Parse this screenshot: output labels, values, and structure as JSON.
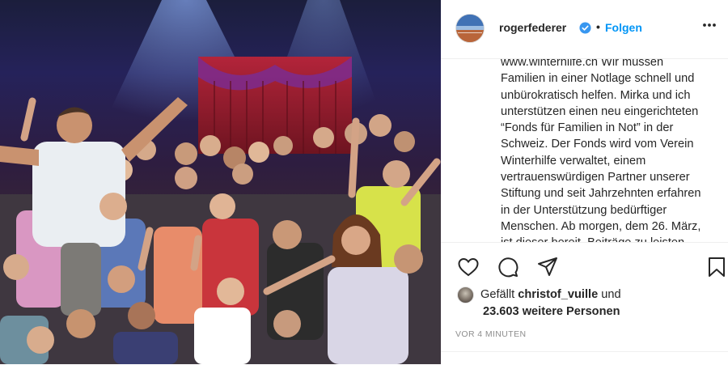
{
  "photo": {
    "alt_icon": "photo-of-crowd"
  },
  "header": {
    "username": "rogerfederer",
    "verified_icon": "verified-badge-icon",
    "separator": "•",
    "follow_label": "Folgen",
    "more_icon": "more-options-icon"
  },
  "caption": {
    "text": "www.winterhilfe.ch Wir müssen\nFamilien in einer Notlage schnell und\nunbürokratisch helfen. Mirka und ich\nunterstützen einen neu eingerichteten\n“Fonds für Familien in Not” in der\nSchweiz. Der Fonds wird vom Verein\nWinterhilfe verwaltet, einem\nvertrauenswürdigen Partner unserer\nStiftung und seit Jahrzehnten erfahren\nin der Unterstützung bedürftiger\nMenschen. Ab morgen, dem 26. März,\nist dieser bereit. Beiträge zu leisten"
  },
  "actions": {
    "like_icon": "heart-icon",
    "comment_icon": "comment-icon",
    "share_icon": "share-icon",
    "save_icon": "bookmark-icon"
  },
  "likes": {
    "prefix": "Gefällt",
    "user": "christof_vuille",
    "conjunction": "und",
    "count_text": "23.603 weitere Personen"
  },
  "timestamp": "VOR 4 MINUTEN",
  "colors": {
    "accent": "#0095f6",
    "text": "#262626",
    "muted": "#8e8e8e",
    "border": "#efefef"
  }
}
